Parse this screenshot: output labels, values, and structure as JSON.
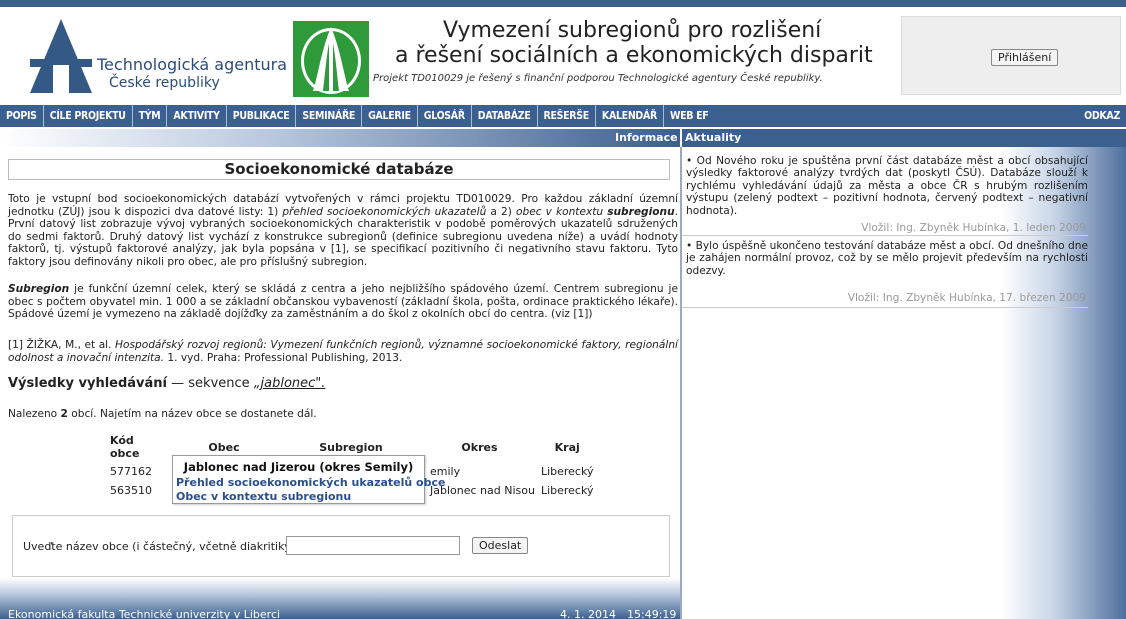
{
  "header": {
    "agency_name": "Technologická agentura",
    "agency_sub": "České republiky",
    "title_line1": "Vymezení subregionů pro rozlišení",
    "title_line2": "a řešení sociálních a ekonomických disparit",
    "subtitle": "Projekt TD010029 je řešený s finanční podporou Technologické agentury České republiky.",
    "login_label": "Přihlášení"
  },
  "nav": {
    "items": [
      "POPIS",
      "CÍLE PROJEKTU",
      "TÝM",
      "AKTIVITY",
      "PUBLIKACE",
      "SEMINÁŘE",
      "GALERIE",
      "GLOSÁŘ",
      "DATABÁZE",
      "REŠERŠE",
      "KALENDÁŘ",
      "WEB EF"
    ],
    "right_item": "ODKAZ"
  },
  "subnav": {
    "informace": "Informace",
    "aktuality": "Aktuality"
  },
  "main": {
    "page_title": "Socioekonomické databáze",
    "p1_a": "Toto je vstupní bod socioekonomických databází vytvořených v rámci projektu TD010029. Pro každou základní územní jednotku (ZÚJ) jsou k dispozici dva datové listy: 1) ",
    "p1_link1": "přehled socioekonomických ukazatelů",
    "p1_b": " a 2) ",
    "p1_link2": "obec v kontextu ",
    "p1_link2b": "subregionu",
    "p1_c": ". První datový list zobrazuje vývoj vybraných socioekonomických charakteristik v podobě poměrových ukazatelů sdružených do sedmi faktorů. Druhý datový list vychází z konstrukce subregionů (definice subregionu uvedena níže) a uvádí hodnoty faktorů, tj. výstupů faktorové analýzy, jak byla popsána v [1], se specifikací pozitivního či negativního stavu faktoru. Tyto faktory jsou definovány nikoli pro obec, ale pro příslušný subregion.",
    "p2_term": "Subregion",
    "p2_text": " je funkční územní celek, který se skládá z centra a jeho nejbližšího spádového území. Centrem subregionu je obec s počtem obyvatel min. 1 000 a se základní občanskou vybaveností (základní škola, pošta, ordinace praktického lékaře). Spádové území je vymezeno na základě dojížďky za zaměstnáním a do škol z okolních obcí do centra. (viz [1])",
    "p3_a": "[1] ŽIŽKA, M., et al. ",
    "p3_title": "Hospodářský rozvoj regionů: Vymezení funkčních regionů, významné socioekonomické faktory, regionální odolnost a inovační intenzita.",
    "p3_b": " 1. vyd. Praha: Professional Publishing, 2013.",
    "results_label": "Výsledky vyhledávání",
    "results_dash": " — sekvence ",
    "results_query": "„jablonec\".",
    "found_a": "Nalezeno ",
    "found_count": "2",
    "found_b": " obcí. Najetím na název obce se dostanete dál.",
    "table": {
      "headers": [
        "Kód obce",
        "Obec",
        "Subregion",
        "Okres",
        "Kraj"
      ],
      "rows": [
        {
          "kod": "577162",
          "okres_tail": "emily",
          "kraj": "Liberecký"
        },
        {
          "kod": "563510",
          "okres_tail": "Jablonec nad Nisou",
          "kraj": "Liberecký"
        }
      ]
    },
    "popup": {
      "title": "Jablonec nad Jizerou (okres Semily)",
      "link1": "Přehled socioekonomických ukazatelů obce",
      "link2": "Obec v kontextu subregionu"
    },
    "search": {
      "label": "Uveďte název obce (i částečný, včetně diakritiky):",
      "value": "",
      "button": "Odeslat"
    }
  },
  "footer": {
    "institution": "Ekonomická fakulta Technické univerzity v Liberci",
    "date": "4. 1. 2014",
    "time": "15:49:19"
  },
  "news": [
    {
      "text": "• Od Nového roku je spuštěna první část databáze měst a obcí obsahující výsledky faktorové analýzy tvrdých dat (poskytl ČSÚ). Databáze slouží k rychlému vyhledávání údajů za města a obce ČR s hrubým rozlišením výstupu (zelený podtext – pozitivní hodnota, červený podtext – negativní hodnota).",
      "signature": "Vložil: Ing. Zbyněk Hubínka, 1. leden 2009"
    },
    {
      "text": "• Bylo úspěšně ukončeno testování databáze měst a obcí. Od dnešního dne je zahájen normální provoz, což by se mělo projevit především na rychlosti odezvy.",
      "signature": "Vložil: Ing. Zbyněk Hubínka, 17. březen 2009"
    }
  ],
  "colors": {
    "nav_blue": "#3b5f8e",
    "link_blue": "#2a4f8f",
    "logo_green": "#2e9a3a"
  }
}
